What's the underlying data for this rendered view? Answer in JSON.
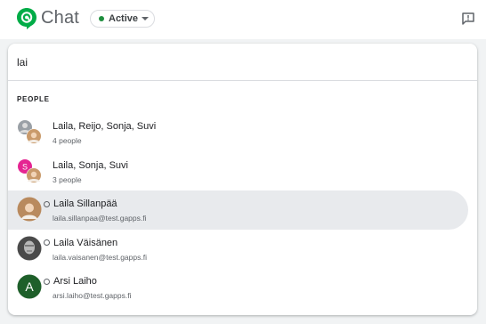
{
  "app": {
    "title": "Chat"
  },
  "status": {
    "label": "Active",
    "color": "#1e8e3e"
  },
  "search": {
    "value": "lai"
  },
  "results": {
    "section_label": "PEOPLE",
    "items": [
      {
        "title": "Laila, Reijo, Sonja, Suvi",
        "subtitle": "4 people",
        "avatar": "group-avatar-photos"
      },
      {
        "title": "Laila, Sonja, Suvi",
        "subtitle": "3 people",
        "avatar": "group-avatar-initial",
        "initial": "S"
      },
      {
        "title": "Laila Sillanpää",
        "subtitle": "laila.sillanpaa@test.gapps.fi",
        "avatar": "photo-avatar",
        "selected": true
      },
      {
        "title": "Laila Väisänen",
        "subtitle": "laila.vaisanen@test.gapps.fi",
        "avatar": "photo-avatar-bw"
      },
      {
        "title": "Arsi Laiho",
        "subtitle": "arsi.laiho@test.gapps.fi",
        "avatar": "letter-avatar",
        "initial": "A"
      }
    ]
  },
  "icons": {
    "logo": "google-chat-logo-icon",
    "dropdown": "caret-down-icon",
    "feedback": "feedback-icon"
  },
  "colors": {
    "accent": "#1e8e3e",
    "logo_green": "#00ac47",
    "selected_row": "#e8eaed",
    "avatar_pink": "#e52592",
    "avatar_dark_green": "#1e5f2a"
  }
}
